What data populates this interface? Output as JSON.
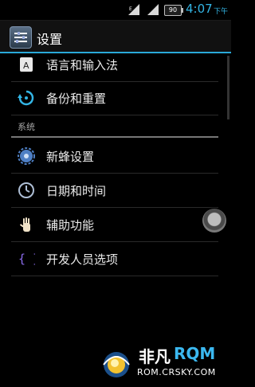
{
  "status_bar": {
    "time": "4:07",
    "ampm": "下午",
    "battery_level": "90"
  },
  "action_bar": {
    "title": "设置"
  },
  "list": {
    "items_top": [
      {
        "label": "语言和输入法",
        "icon": "language-icon"
      },
      {
        "label": "备份和重置",
        "icon": "backup-icon"
      }
    ],
    "section_header": "系统",
    "items_system": [
      {
        "label": "新蜂设置",
        "icon": "gear-icon"
      },
      {
        "label": "日期和时间",
        "icon": "clock-icon"
      },
      {
        "label": "辅助功能",
        "icon": "hand-icon"
      },
      {
        "label": "开发人员选项",
        "icon": "braces-icon"
      }
    ]
  },
  "watermark": {
    "brand_left": "非凡",
    "brand_right": "RQM",
    "url": "ROM.CRSKY.COM"
  }
}
